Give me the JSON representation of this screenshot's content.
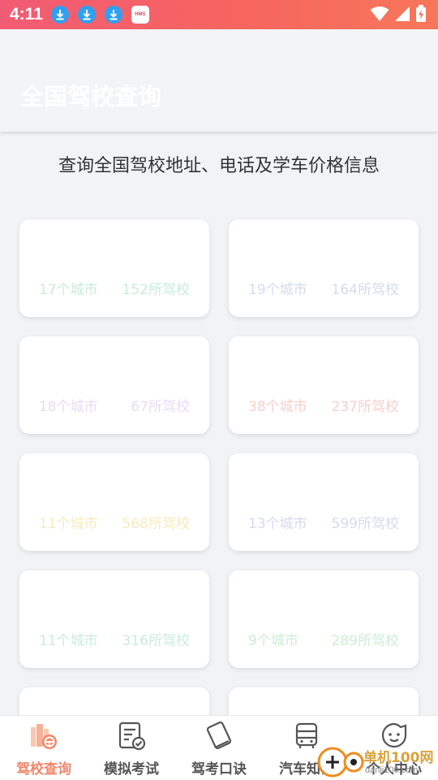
{
  "status_bar": {
    "time": "4:11",
    "icons": [
      "download-icon",
      "download-icon",
      "download-icon",
      "hms-icon",
      "wifi-icon",
      "signal-icon",
      "battery-icon"
    ],
    "hms_label": "HMS"
  },
  "header": {
    "title": "全国驾校查询"
  },
  "subtitle": "查询全国驾校地址、电话及学车价格信息",
  "cards": [
    {
      "cities": "17个城市",
      "schools": "152所驾校",
      "color": "#c9ecd9"
    },
    {
      "cities": "19个城市",
      "schools": "164所驾校",
      "color": "#d3dcec"
    },
    {
      "cities": "18个城市",
      "schools": "67所驾校",
      "color": "#e6dcf4"
    },
    {
      "cities": "38个城市",
      "schools": "237所驾校",
      "color": "#f6d0cc"
    },
    {
      "cities": "11个城市",
      "schools": "568所驾校",
      "color": "#f7ebbd"
    },
    {
      "cities": "13个城市",
      "schools": "599所驾校",
      "color": "#d3dcec"
    },
    {
      "cities": "11个城市",
      "schools": "316所驾校",
      "color": "#c9ecdf"
    },
    {
      "cities": "9个城市",
      "schools": "289所驾校",
      "color": "#cdeed3"
    },
    {
      "cities": "",
      "schools": "",
      "color": "#dddddd"
    },
    {
      "cities": "",
      "schools": "",
      "color": "#dddddd"
    }
  ],
  "bottom_nav": [
    {
      "label": "驾校查询",
      "icon": "driving-school-icon",
      "active": true
    },
    {
      "label": "模拟考试",
      "icon": "exam-paper-icon",
      "active": false
    },
    {
      "label": "驾考口诀",
      "icon": "cards-icon",
      "active": false
    },
    {
      "label": "汽车知识",
      "icon": "bus-icon",
      "active": false
    },
    {
      "label": "个人中心",
      "icon": "smiley-icon",
      "active": false
    }
  ],
  "watermark": {
    "text": "单机100网",
    "url": "danji100.com"
  },
  "colors": {
    "accent": "#f2866a",
    "status_bar": "#f25b74",
    "download_badge": "#2ea0f0"
  }
}
